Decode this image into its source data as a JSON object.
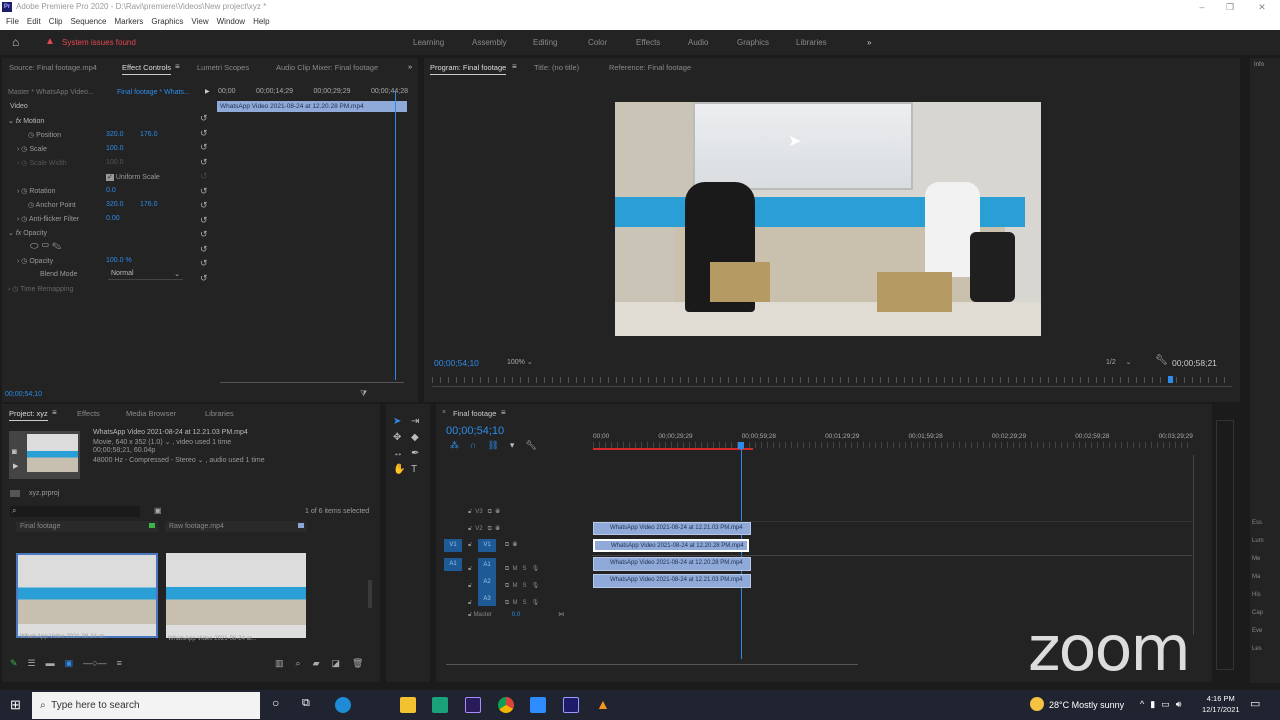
{
  "window": {
    "app_icon": "Pr",
    "title": "Adobe Premiere Pro 2020 - D:\\Ravi\\premiere\\Videos\\New project\\xyz *"
  },
  "menu": [
    "File",
    "Edit",
    "Clip",
    "Sequence",
    "Markers",
    "Graphics",
    "View",
    "Window",
    "Help"
  ],
  "header": {
    "warning": "System issues found",
    "workspaces": [
      "Learning",
      "Assembly",
      "Editing",
      "Color",
      "Effects",
      "Audio",
      "Graphics",
      "Libraries"
    ],
    "more": "»"
  },
  "source_panel": {
    "tabs": [
      "Source: Final footage.mp4",
      "Effect Controls",
      "Lumetri Scopes",
      "Audio Clip Mixer: Final footage"
    ],
    "more": "»",
    "master": "Master * WhatsApp Video...",
    "sequence": "Final footage * Whats...",
    "ruler": [
      "00;00",
      "00;00;14;29",
      "00;00;29;29",
      "00;00;44;28"
    ],
    "clip": "WhatsApp Video 2021-08-24 at 12.20.28 PM.mp4",
    "section": "Video",
    "motion": "Motion",
    "position_label": "Position",
    "position_x": "320.0",
    "position_y": "176.0",
    "scale_label": "Scale",
    "scale": "100.0",
    "scale_width_label": "Scale Width",
    "scale_width": "100.0",
    "uniform_scale": "Uniform Scale",
    "rotation_label": "Rotation",
    "rotation": "0.0",
    "anchor_label": "Anchor Point",
    "anchor_x": "320.0",
    "anchor_y": "176.0",
    "flicker_label": "Anti-flicker Filter",
    "flicker": "0.00",
    "opacity_section": "Opacity",
    "opacity_label": "Opacity",
    "opacity": "100.0 %",
    "blend_label": "Blend Mode",
    "blend": "Normal",
    "time_remap": "Time Remapping",
    "timecode": "00;00;54;10"
  },
  "program": {
    "tabs": [
      "Program: Final footage",
      "Title: (no title)",
      "Reference: Final footage"
    ],
    "timecode": "00;00;54;10",
    "zoom": "100%",
    "quality": "1/2",
    "duration": "00;00;58;21"
  },
  "project": {
    "tabs": [
      "Project: xyz",
      "Effects",
      "Media Browser",
      "Libraries"
    ],
    "file_name": "WhatsApp Video 2021-08-24 at 12.21.03 PM.mp4",
    "file_info1": "Movie, 640 x 352 (1.0)  ⌄ , video used 1 time",
    "file_info2": "00;00;58;21, 60.04p",
    "file_info3": "48000 Hz - Compressed - Stereo  ⌄ , audio used 1 time",
    "proj_file": "xyz.prproj",
    "selected": "1 of 6 items selected",
    "bins": [
      {
        "name": "Final footage"
      },
      {
        "name": "Raw footage.mp4"
      }
    ],
    "thumbs": [
      {
        "name": "WhatsApp Video 2021-08-24 at..."
      },
      {
        "name": "WhatsApp Video 2021-08-24 at..."
      }
    ]
  },
  "timeline": {
    "title": "Final footage",
    "timecode": "00;00;54;10",
    "ruler": [
      "00;00",
      "00;00;29;29",
      "00;00;59;28",
      "00;01;29;29",
      "00;01;59;28",
      "00;02;29;29",
      "00;02;59;28",
      "00;03;29;29"
    ],
    "tracks": {
      "v3": "V3",
      "v2": "V2",
      "v1": "V1",
      "a1": "A1",
      "a2": "A2",
      "a3": "A3",
      "master": "Master",
      "master_val": "0.0",
      "m": "M",
      "s": "S"
    },
    "clips": {
      "v2": "WhatsApp Video 2021-08-24 at 12.21.03 PM.mp4",
      "v1": "WhatsApp Video 2021-08-24 at 12.20.28 PM.mp4",
      "a1": "WhatsApp Video 2021-08-24 at 12.20.28 PM.mp4",
      "a2": "WhatsApp Video 2021-08-24 at 12.21.03 PM.mp4"
    }
  },
  "right_panel": [
    "Ess",
    "Lum",
    "Me",
    "Ma",
    "His",
    "Cap",
    "Eve",
    "Les"
  ],
  "watermark": "zoom",
  "taskbar": {
    "search": "Type here to search",
    "weather": "28°C  Mostly sunny",
    "time": "4:16 PM",
    "date": "12/17/2021"
  }
}
